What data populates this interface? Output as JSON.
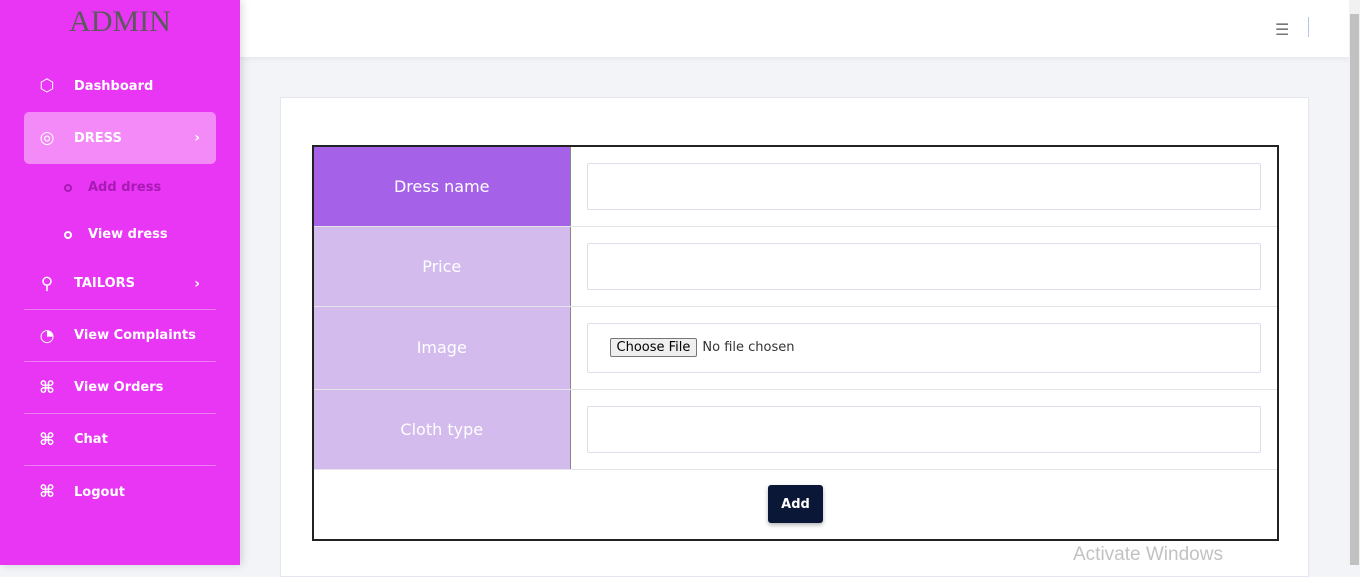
{
  "sidebar": {
    "logo": "ADMIN",
    "items": [
      {
        "label": "Dashboard",
        "icon": "cube-icon"
      },
      {
        "label": "DRESS",
        "icon": "target-icon",
        "sub": [
          {
            "label": "Add dress"
          },
          {
            "label": "View dress"
          }
        ]
      },
      {
        "label": "TAILORS",
        "icon": "user-icon"
      },
      {
        "label": "View Complaints",
        "icon": "pie-chart-icon"
      },
      {
        "label": "View Orders",
        "icon": "command-icon"
      },
      {
        "label": "Chat",
        "icon": "command-icon"
      },
      {
        "label": "Logout",
        "icon": "command-icon"
      }
    ]
  },
  "form": {
    "fields": [
      {
        "label": "Dress name",
        "value": ""
      },
      {
        "label": "Price",
        "value": ""
      },
      {
        "label": "Image",
        "file_button": "Choose File",
        "file_status": "No file chosen"
      },
      {
        "label": "Cloth type",
        "value": ""
      }
    ],
    "submit": "Add"
  },
  "watermark": "Activate Windows",
  "colors": {
    "sidebar": "#e936f5",
    "header_cell": "#a562e8",
    "label_cell": "#d4bbed",
    "button": "#0b1736"
  }
}
